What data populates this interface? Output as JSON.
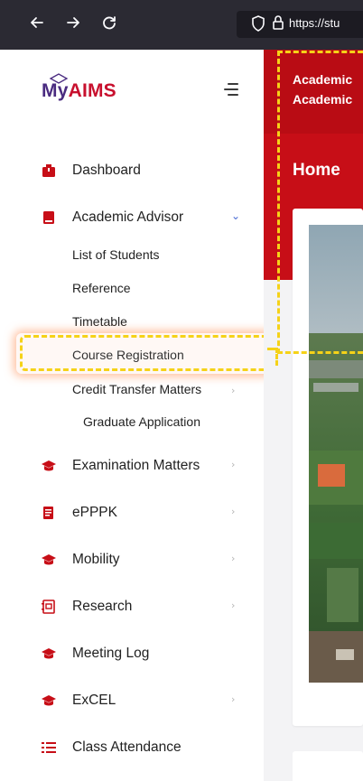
{
  "browser": {
    "url": "https://stu",
    "back_icon": "arrow-left-icon",
    "forward_icon": "arrow-right-icon",
    "reload_icon": "reload-icon"
  },
  "logo": {
    "my": "My",
    "aims": "AIMS"
  },
  "sidebar": {
    "items": [
      {
        "label": "Dashboard",
        "icon": "dashboard-icon",
        "arrow": ""
      },
      {
        "label": "Academic Advisor",
        "icon": "book-icon",
        "arrow": "⌄"
      },
      {
        "label": "Examination Matters",
        "icon": "graduation-cap-icon",
        "arrow": "›"
      },
      {
        "label": "ePPPK",
        "icon": "document-icon",
        "arrow": "›"
      },
      {
        "label": "Mobility",
        "icon": "graduation-cap-icon",
        "arrow": "›"
      },
      {
        "label": "Research",
        "icon": "research-icon",
        "arrow": "›"
      },
      {
        "label": "Meeting Log",
        "icon": "graduation-cap-icon",
        "arrow": ""
      },
      {
        "label": "ExCEL",
        "icon": "graduation-cap-icon",
        "arrow": "›"
      },
      {
        "label": "Class Attendance",
        "icon": "list-icon",
        "arrow": ""
      }
    ],
    "subitems": [
      {
        "label": "List of Students"
      },
      {
        "label": "Reference"
      },
      {
        "label": "Timetable"
      },
      {
        "label": "Course Registration"
      },
      {
        "label": "Credit Transfer Matters",
        "arrow": "›"
      },
      {
        "label": "Graduate Application"
      }
    ]
  },
  "header": {
    "line1": "Academic",
    "line2": "Academic"
  },
  "main": {
    "title": "Home"
  },
  "colors": {
    "brand_red": "#c70e17",
    "brand_purple": "#4a2b80",
    "highlight": "#f5d218"
  }
}
